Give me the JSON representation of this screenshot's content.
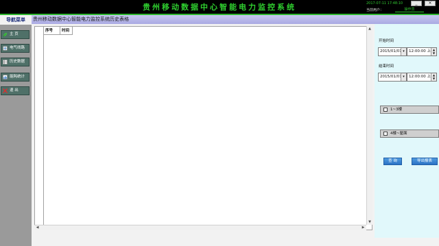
{
  "header": {
    "title": "贵州移动数据中心智能电力监控系统",
    "datetime": "2017-07-11 17:48:10",
    "user_label": "当前用户：",
    "user_name": "操作员",
    "minimize": "_",
    "close": "×"
  },
  "sidebar": {
    "title": "导航菜单",
    "items": [
      {
        "label": "主 页",
        "icon": "leaf-icon",
        "color": "#3fbf3f"
      },
      {
        "label": "电气线路",
        "icon": "circuit-icon",
        "color": "#cfd8dc"
      },
      {
        "label": "历史数据",
        "icon": "table-icon",
        "color": "#cfd8dc"
      },
      {
        "label": "能耗统计",
        "icon": "chart-icon",
        "color": "#cfd8dc"
      },
      {
        "label": "退 出",
        "icon": "exit-icon",
        "color": "#d93030"
      }
    ]
  },
  "table": {
    "title": "贵州移动数据中心智能电力监控系统历史表格",
    "columns": [
      "序号",
      "时间"
    ]
  },
  "filters": {
    "start_label": "开始时间",
    "start_date": "2015/01/01",
    "start_time": "12:00:00 上午",
    "end_label": "结束时间",
    "end_date": "2015/01/01",
    "end_time": "12:00:00 上午",
    "group1": "1~3楼",
    "group2": "4楼~屋面"
  },
  "buttons": {
    "query": "查 询",
    "export": "导出报表"
  },
  "colors": {
    "header_bg": "#000000",
    "title_green": "#2fcf2f",
    "sidebar_bg": "#9a9a9a",
    "nav_item_bg": "#4f7068",
    "right_panel_bg": "#e1f8fb",
    "button_blue": "#2b72c4"
  }
}
